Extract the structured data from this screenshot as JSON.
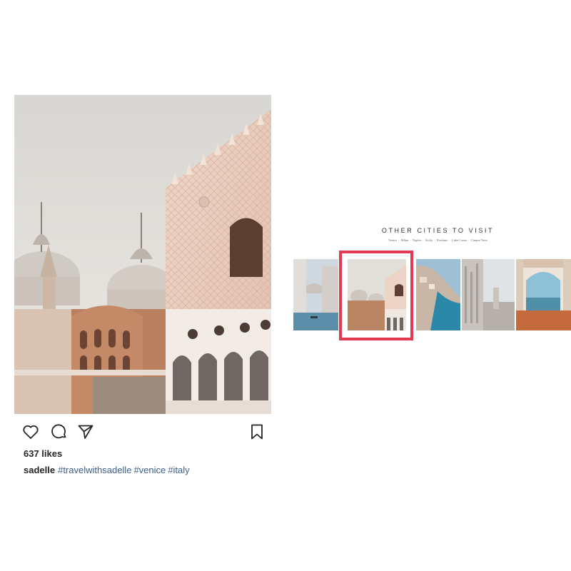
{
  "post": {
    "photo_alt": "Venice basilica photo",
    "likes": "637 likes",
    "username": "sadelle",
    "hashtags": [
      "#travelwithsadelle",
      "#venice",
      "#italy"
    ]
  },
  "icons": {
    "like": "heart-icon",
    "comment": "comment-icon",
    "share": "paper-plane-icon",
    "save": "bookmark-icon"
  },
  "site": {
    "title": "OTHER CITIES TO VISIT",
    "cities": [
      "Venice",
      "Milan",
      "Naples",
      "Sicily",
      "Positano",
      "Lake Como",
      "Cinque Terre"
    ],
    "separator": "·",
    "highlight_color": "#e23a52"
  }
}
